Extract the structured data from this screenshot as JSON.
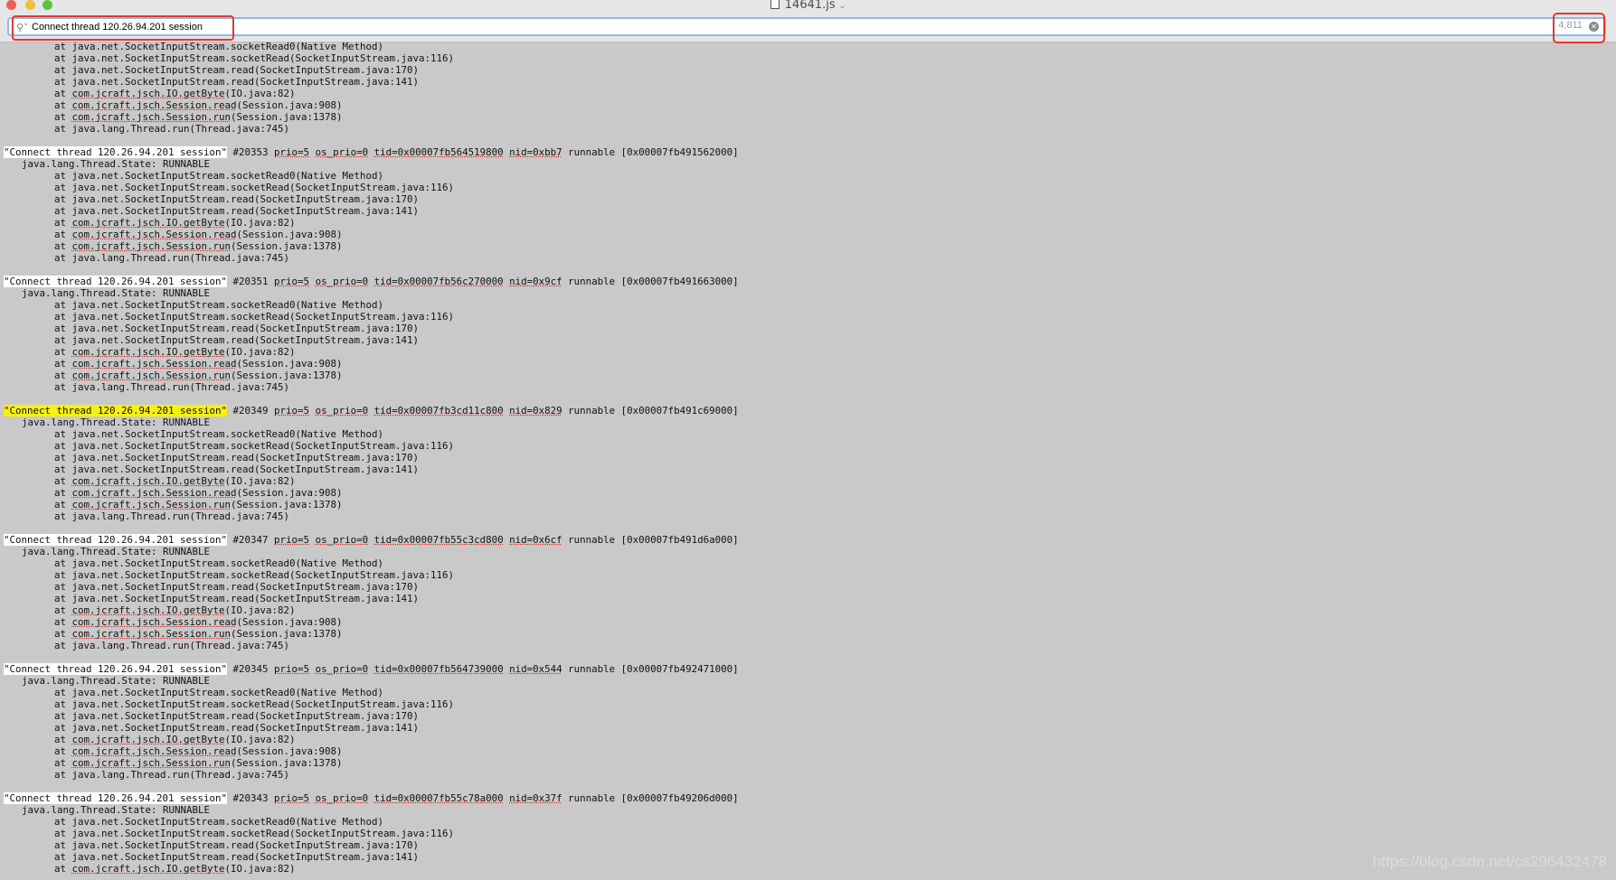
{
  "window": {
    "title": "14641.js",
    "title_icon": "document-icon",
    "title_chevron": "chevron-down-icon"
  },
  "find": {
    "query": "Connect thread 120.26.94.201 session",
    "match_count": "4,811"
  },
  "log": {
    "at": "at",
    "state_line": "java.lang.Thread.State: RUNNABLE",
    "frames": [
      "java.net.SocketInputStream.socketRead0(Native Method)",
      "java.net.SocketInputStream.socketRead(SocketInputStream.java:116)",
      "java.net.SocketInputStream.read(SocketInputStream.java:170)",
      "java.net.SocketInputStream.read(SocketInputStream.java:141)",
      "com.jcraft.jsch.IO.getByte(IO.java:82)",
      "com.jcraft.jsch.Session.read(Session.java:908)",
      "com.jcraft.jsch.Session.run(Session.java:1378)",
      "java.lang.Thread.run(Thread.java:745)"
    ],
    "threads": [
      {
        "name": "Connect thread 120.26.94.201 session",
        "num": "#20353",
        "prio": "prio=5",
        "os_prio": "os_prio=0",
        "tid": "tid=0x00007fb564519800",
        "nid": "nid=0xbb7",
        "state": "runnable",
        "addr": "[0x00007fb491562000]"
      },
      {
        "name": "Connect thread 120.26.94.201 session",
        "num": "#20351",
        "prio": "prio=5",
        "os_prio": "os_prio=0",
        "tid": "tid=0x00007fb56c270000",
        "nid": "nid=0x9cf",
        "state": "runnable",
        "addr": "[0x00007fb491663000]"
      },
      {
        "name": "Connect thread 120.26.94.201 session",
        "num": "#20349",
        "prio": "prio=5",
        "os_prio": "os_prio=0",
        "tid": "tid=0x00007fb3cd11c800",
        "nid": "nid=0x829",
        "state": "runnable",
        "addr": "[0x00007fb491c69000]",
        "current": true
      },
      {
        "name": "Connect thread 120.26.94.201 session",
        "num": "#20347",
        "prio": "prio=5",
        "os_prio": "os_prio=0",
        "tid": "tid=0x00007fb55c3cd800",
        "nid": "nid=0x6cf",
        "state": "runnable",
        "addr": "[0x00007fb491d6a000]"
      },
      {
        "name": "Connect thread 120.26.94.201 session",
        "num": "#20345",
        "prio": "prio=5",
        "os_prio": "os_prio=0",
        "tid": "tid=0x00007fb564739000",
        "nid": "nid=0x544",
        "state": "runnable",
        "addr": "[0x00007fb492471000]"
      },
      {
        "name": "Connect thread 120.26.94.201 session",
        "num": "#20343",
        "prio": "prio=5",
        "os_prio": "os_prio=0",
        "tid": "tid=0x00007fb55c78a000",
        "nid": "nid=0x37f",
        "state": "runnable",
        "addr": "[0x00007fb49206d000]",
        "truncated": true
      }
    ]
  },
  "watermark": "https://blog.csdn.net/cs296432478"
}
